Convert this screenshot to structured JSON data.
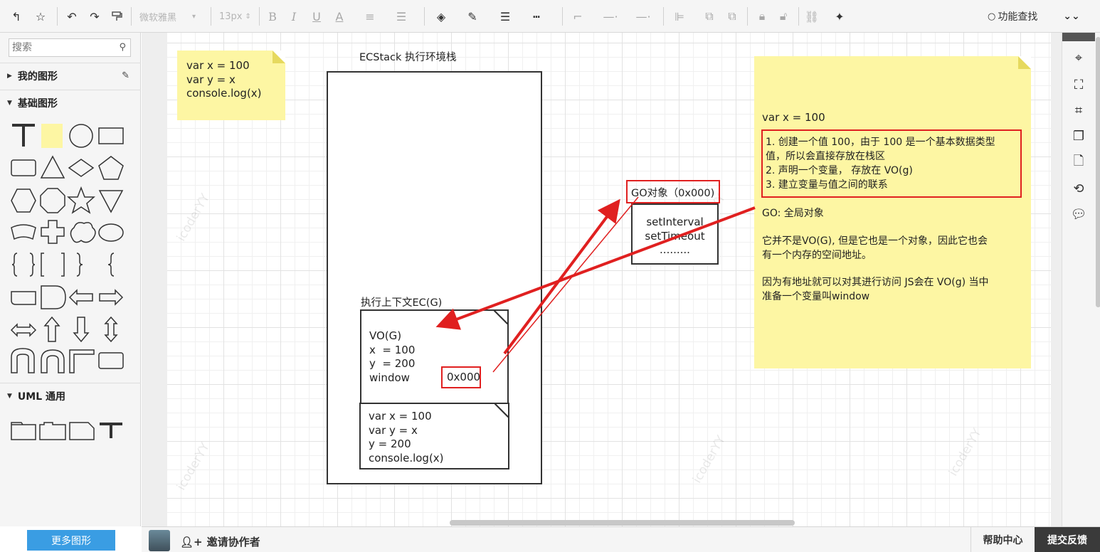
{
  "toolbar": {
    "font_family": "微软雅黑",
    "font_size": "13px",
    "search_label": "功能查找"
  },
  "left_panel": {
    "search_placeholder": "搜索",
    "my_shapes": "我的图形",
    "basic_shapes": "基础图形",
    "uml": "UML 通用",
    "more_shapes": "更多图形"
  },
  "canvas": {
    "note_small_lines": "var x = 100\nvar y = x\nconsole.log(x)",
    "ecstack_title": "ECStack 执行环境栈",
    "ec_label": "执行上下文EC(G)",
    "vo_lines": "VO(G)\nx  = 100\ny  = 200\nwindow",
    "address": "0x000",
    "code_lines": "var x = 100\nvar y = x\ny = 200\nconsole.log(x)",
    "go_title": "GO对象（0x000)",
    "go_lines": "setInterval\nsetTimeout\n.........",
    "note_big": {
      "line1": "var x = 100",
      "highlight_lines": "1. 创建一个值 100，由于 100 是一个基本数据类型\n值，所以会直接存放在栈区\n2. 声明一个变量， 存放在 VO(g)\n3. 建立变量与值之间的联系",
      "go_desc": "GO: 全局对象",
      "para1": "它并不是VO(G), 但是它也是一个对象，因此它也会\n有一个内存的空间地址。",
      "para2": "因为有地址就可以对其进行访问 JS会在 VO(g) 当中\n准备一个变量叫window"
    },
    "watermark": "icoderYY"
  },
  "bottom": {
    "invite": "邀请协作者",
    "help": "帮助中心",
    "feedback": "提交反馈"
  },
  "colors": {
    "note_yellow": "#fdf6a3",
    "highlight_red": "#e02020",
    "accent_blue": "#3a9de3"
  }
}
